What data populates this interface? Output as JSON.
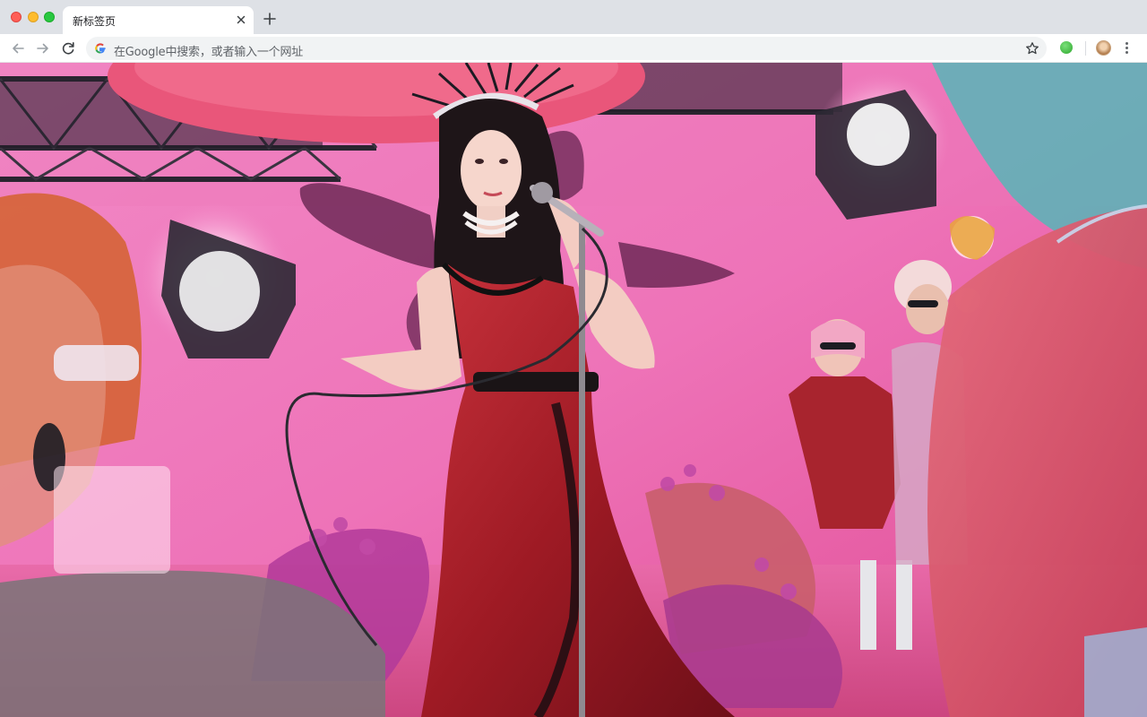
{
  "window": {
    "controls": [
      "close",
      "minimize",
      "maximize"
    ]
  },
  "tab": {
    "title": "新标签页"
  },
  "toolbar": {
    "icons": [
      "back-arrow-icon",
      "forward-arrow-icon",
      "reload-icon"
    ]
  },
  "omnibox": {
    "placeholder": "在Google中搜索，或者输入一个网址",
    "icon": "google-g-icon",
    "bookmark_icon": "star-icon"
  },
  "extensions": {
    "items": [
      "green-extension-icon"
    ],
    "profile": "profile-avatar"
  },
  "background": {
    "description": "new tab page wallpaper image",
    "accent_colors": [
      "#f07ab8",
      "#b3222c",
      "#1a1a22",
      "#5fd1d6"
    ]
  }
}
